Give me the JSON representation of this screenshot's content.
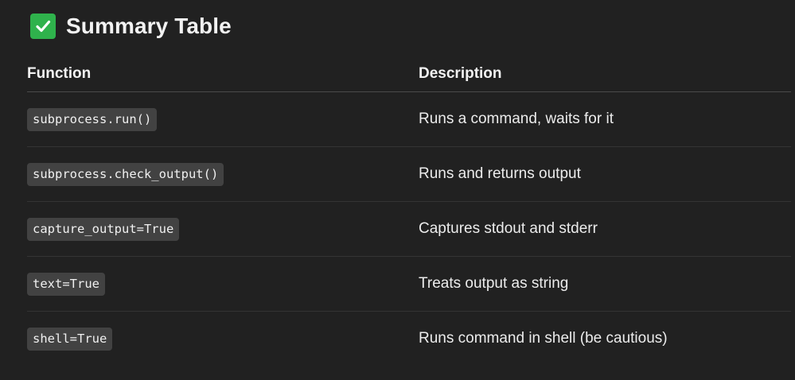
{
  "heading": {
    "icon": "check-mark-button-icon",
    "title": "Summary Table"
  },
  "table": {
    "headers": [
      "Function",
      "Description"
    ],
    "rows": [
      {
        "function": "subprocess.run()",
        "description": "Runs a command, waits for it"
      },
      {
        "function": "subprocess.check_output()",
        "description": "Runs and returns output"
      },
      {
        "function": "capture_output=True",
        "description": "Captures stdout and stderr"
      },
      {
        "function": "text=True",
        "description": "Treats output as string"
      },
      {
        "function": "shell=True",
        "description": "Runs command in shell (be cautious)"
      }
    ]
  },
  "colors": {
    "background": "#212121",
    "check_icon": "#2fb24c",
    "code_background": "#424242"
  }
}
